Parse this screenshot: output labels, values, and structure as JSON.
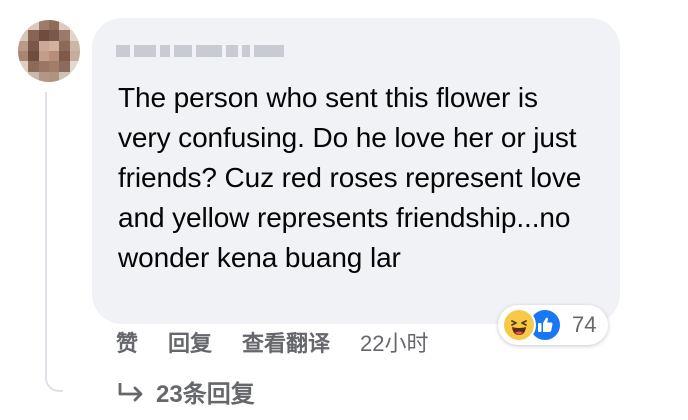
{
  "comment": {
    "author_name": "",
    "text": "The person who sent this flower is very confusing. Do he love her or just friends? Cuz red roses represent love and yellow represents friendship...no wonder kena buang lar"
  },
  "reactions": {
    "icons": [
      "haha-emoji-icon",
      "like-thumb-icon"
    ],
    "count": "74",
    "colors": {
      "haha": "#f7c948",
      "like": "#1877f2"
    }
  },
  "actions": {
    "like_label": "赞",
    "reply_label": "回复",
    "translate_label": "查看翻译",
    "timestamp": "22小时"
  },
  "replies": {
    "label": "23条回复",
    "icon": "reply-arrow-icon"
  }
}
